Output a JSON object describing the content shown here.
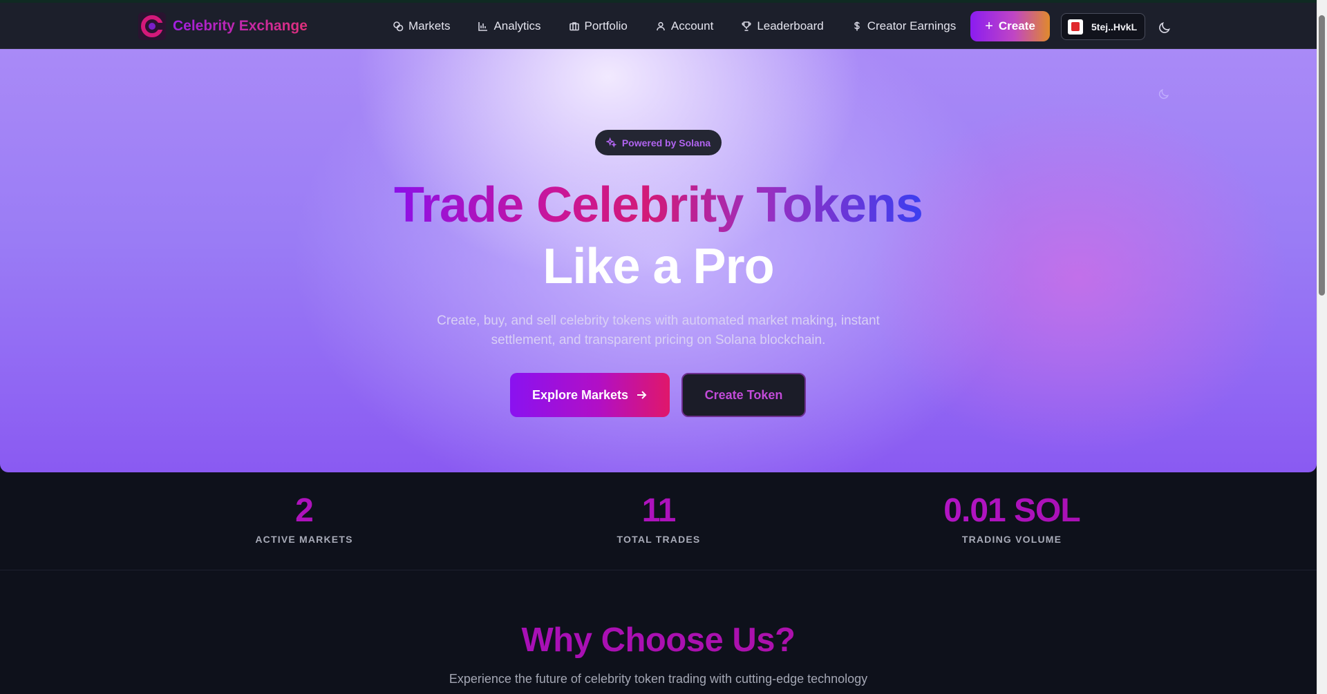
{
  "brand": {
    "name": "Celebrity Exchange",
    "logo_icon": "celebrity-exchange-logo"
  },
  "nav": {
    "items": [
      {
        "label": "Markets",
        "icon": "markets-icon"
      },
      {
        "label": "Analytics",
        "icon": "bar-chart-icon"
      },
      {
        "label": "Portfolio",
        "icon": "briefcase-icon"
      },
      {
        "label": "Account",
        "icon": "user-icon"
      },
      {
        "label": "Leaderboard",
        "icon": "trophy-icon"
      },
      {
        "label": "Creator Earnings",
        "icon": "dollar-icon"
      }
    ],
    "create_label": "Create",
    "wallet_label": "5tej..HvkL",
    "theme_icon": "moon-icon"
  },
  "hero": {
    "badge": "Powered by Solana",
    "headline_line1": "Trade Celebrity Tokens",
    "headline_line2": "Like a Pro",
    "description": "Create, buy, and sell celebrity tokens with automated market making, instant settlement, and transparent pricing on Solana blockchain.",
    "primary_cta": "Explore Markets",
    "secondary_cta": "Create Token"
  },
  "stats": [
    {
      "value": "2",
      "label": "ACTIVE MARKETS"
    },
    {
      "value": "11",
      "label": "TOTAL TRADES"
    },
    {
      "value": "0.01 SOL",
      "label": "TRADING VOLUME"
    }
  ],
  "why": {
    "title": "Why Choose Us?",
    "subtitle": "Experience the future of celebrity token trading with cutting-edge technology"
  },
  "colors": {
    "accent_purple": "#8b1cf0",
    "accent_pink": "#e0176a",
    "navbar_bg": "#1c1f2b",
    "page_bg": "#0e111b"
  }
}
